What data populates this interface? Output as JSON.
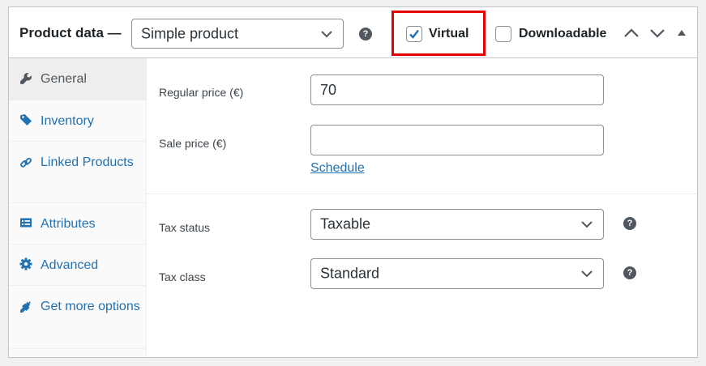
{
  "header": {
    "title": "Product data —",
    "product_type": {
      "selected": "Simple product",
      "icon": "chevron-down-icon"
    },
    "help_icon": "question-circle-icon",
    "virtual": {
      "label": "Virtual",
      "checked": true
    },
    "downloadable": {
      "label": "Downloadable",
      "checked": false
    },
    "controls": [
      "chevron-up-icon",
      "chevron-down-icon",
      "triangle-up-icon"
    ]
  },
  "sidebar": {
    "tabs": [
      {
        "label": "General",
        "icon": "wrench-icon",
        "active": true
      },
      {
        "label": "Inventory",
        "icon": "tag-icon",
        "active": false
      },
      {
        "label": "Linked Products",
        "icon": "link-icon",
        "active": false
      },
      {
        "label": "Attributes",
        "icon": "list-card-icon",
        "active": false
      },
      {
        "label": "Advanced",
        "icon": "gear-icon",
        "active": false
      },
      {
        "label": "Get more options",
        "icon": "plug-icon",
        "active": false
      }
    ]
  },
  "general": {
    "regular_price": {
      "label": "Regular price (€)",
      "value": "70"
    },
    "sale_price": {
      "label": "Sale price (€)",
      "value": ""
    },
    "schedule_link": "Schedule",
    "tax_status": {
      "label": "Tax status",
      "selected": "Taxable"
    },
    "tax_class": {
      "label": "Tax class",
      "selected": "Standard"
    }
  },
  "colors": {
    "accent_link": "#2271b1",
    "highlight_border": "#e60000",
    "checkbox_check": "#2271b1"
  }
}
